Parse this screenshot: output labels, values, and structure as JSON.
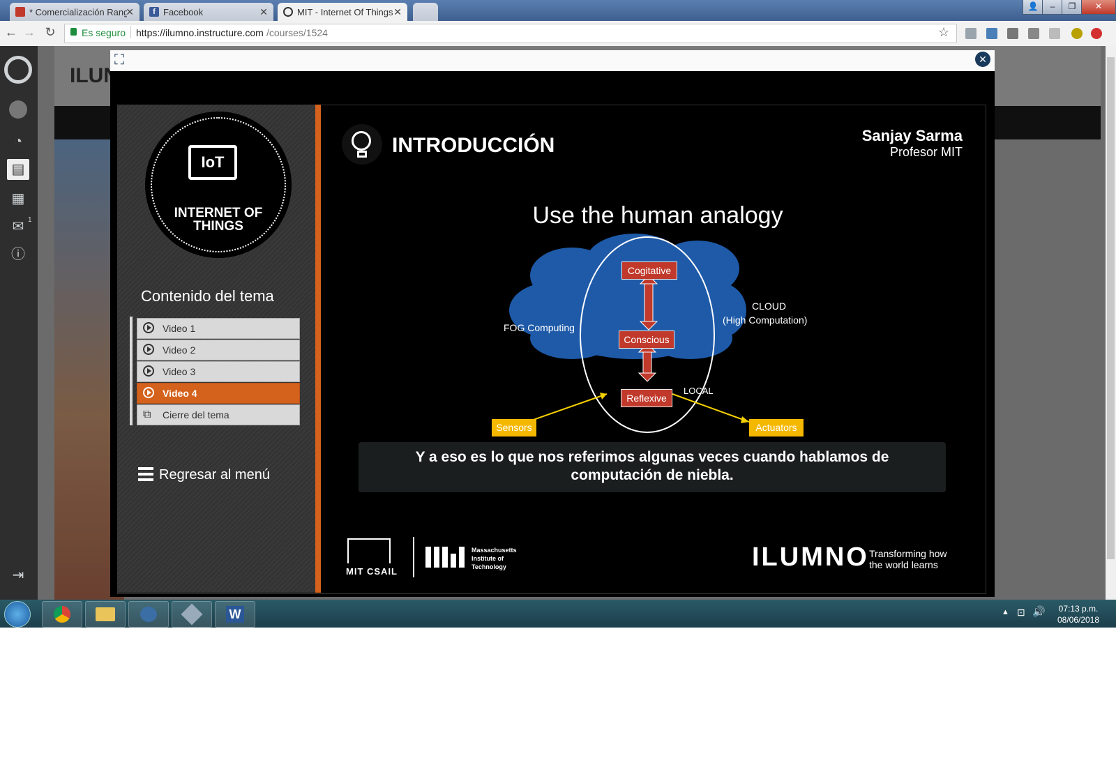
{
  "browser": {
    "tabs": [
      {
        "title": "* Comercialización Rang",
        "active": false
      },
      {
        "title": "Facebook",
        "active": false
      },
      {
        "title": "MIT - Internet Of Things",
        "active": true
      }
    ],
    "secure_label": "Es seguro",
    "url_base": "https://ilumno.instructure.com",
    "url_path": "/courses/1524"
  },
  "lms": {
    "header_text": "ILUN",
    "badge_count": "1"
  },
  "sidebar": {
    "logo_text": "INTERNET OF THINGS",
    "logo_badge": "IoT",
    "section_title": "Contenido del tema",
    "items": [
      {
        "label": "Video 1"
      },
      {
        "label": "Video 2"
      },
      {
        "label": "Video 3"
      },
      {
        "label": "Video 4"
      },
      {
        "label": "Cierre del tema"
      }
    ],
    "back_label": "Regresar al menú"
  },
  "slide": {
    "section_title": "INTRODUCCIÓN",
    "presenter_name": "Sanjay Sarma",
    "presenter_role": "Profesor MIT",
    "heading": "Use the human analogy",
    "diagram": {
      "cogitative": "Cogitative",
      "conscious": "Conscious",
      "reflexive": "Reflexive",
      "fog": "FOG Computing",
      "cloud": "CLOUD",
      "cloud_sub": "(High Computation)",
      "local": "LOCAL",
      "sensors": "Sensors",
      "actuators": "Actuators"
    },
    "subtitle_line1": "Y a eso es lo que nos referimos algunas veces cuando hablamos de",
    "subtitle_line2": "computación de niebla.",
    "footer": {
      "csail": "MIT CSAIL",
      "mit_text1": "Massachusetts",
      "mit_text2": "Institute of",
      "mit_text3": "Technology",
      "ilumno": "ILUMNO",
      "tagline1": "Transforming how",
      "tagline2": "the world learns"
    }
  },
  "taskbar": {
    "time": "07:13 p.m.",
    "date": "08/06/2018"
  }
}
